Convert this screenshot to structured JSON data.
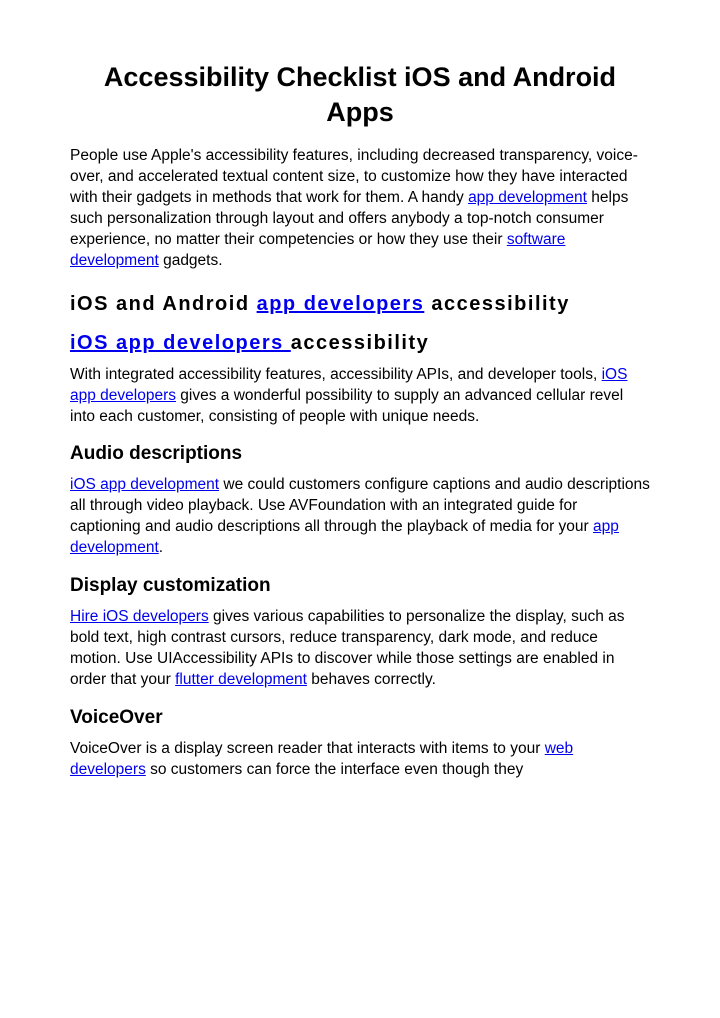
{
  "title": "Accessibility Checklist iOS and Android Apps",
  "intro": {
    "part1": "People use Apple's accessibility features, including decreased transparency, voice-over, and accelerated textual content size, to customize how they have interacted with their gadgets in methods that work for them. A handy ",
    "link1": "app development",
    "part2": " helps such personalization through layout and offers anybody a top-notch consumer experience, no matter their competencies or how they use their ",
    "link2": "software development",
    "part3": " gadgets."
  },
  "h2": {
    "part1": "iOS and Android ",
    "link": "app developers",
    "part2": " accessibility"
  },
  "h3": {
    "link": "iOS app developers ",
    "part2": "accessibility"
  },
  "p2": {
    "part1": "With integrated accessibility features, accessibility APIs, and developer tools, ",
    "link": "iOS app developers",
    "part2": " gives a wonderful possibility to supply an advanced cellular revel into each customer, consisting of people with unique needs."
  },
  "audio_heading": "Audio descriptions",
  "p3": {
    "link1": "iOS app development",
    "part1": " we could customers configure captions and audio descriptions all through video playback. Use AVFoundation with an integrated guide for captioning and audio descriptions all through the playback of media for your ",
    "link2": "app development",
    "part2": "."
  },
  "display_heading": "Display customization",
  "p4": {
    "link1": "Hire iOS developers",
    "part1": " gives various capabilities to personalize the display, such as bold text, high contrast cursors, reduce transparency, dark mode, and reduce motion. Use UIAccessibility APIs to discover while those settings are enabled in order that your ",
    "link2": "flutter development",
    "part2": " behaves correctly."
  },
  "voiceover_heading": "VoiceOver",
  "p5": {
    "part1": "VoiceOver is a display screen reader that interacts with items to your ",
    "link": "web developers",
    "part2": " so customers can force the interface even though they"
  }
}
